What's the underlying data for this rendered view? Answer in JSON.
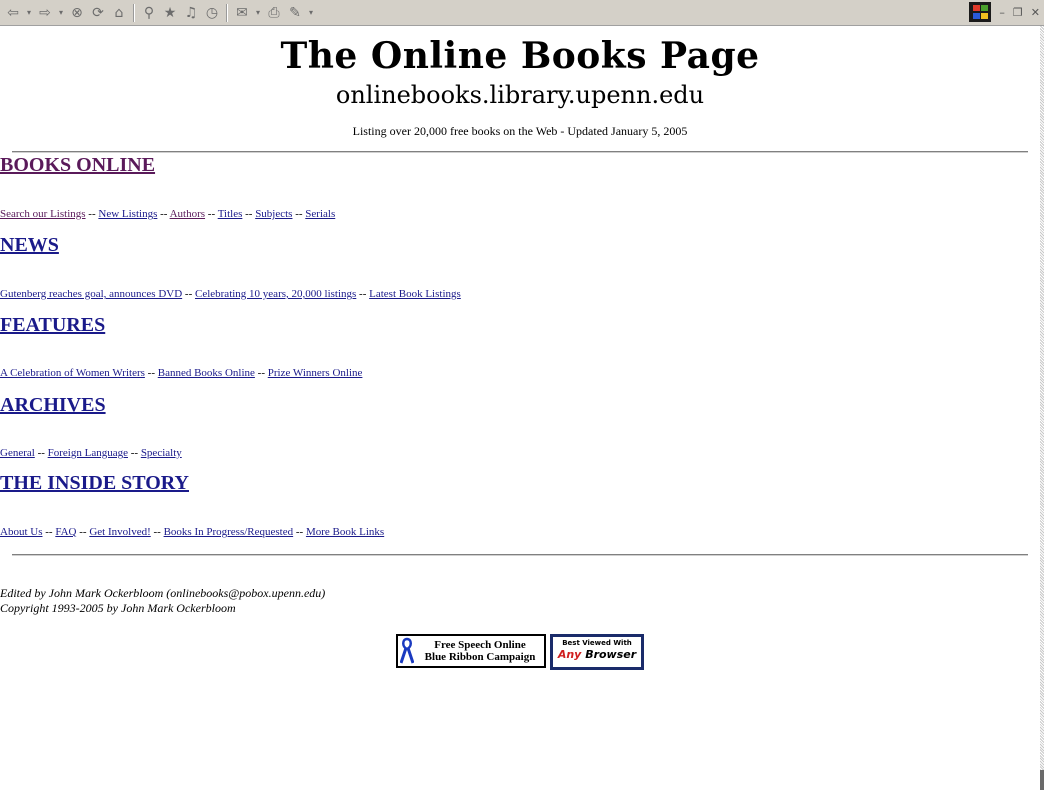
{
  "toolbar": {
    "buttons": [
      "back-icon",
      "forward-icon",
      "stop-icon",
      "refresh-icon",
      "home-icon",
      "search-icon",
      "favorites-icon",
      "media-icon",
      "history-icon",
      "mail-icon",
      "print-icon",
      "edit-icon"
    ]
  },
  "header": {
    "title": "The Online Books Page",
    "url": "onlinebooks.library.upenn.edu",
    "tagline": "Listing over 20,000 free books on the Web - Updated January 5, 2005"
  },
  "sections": {
    "books": {
      "title": "BOOKS ONLINE",
      "links": [
        "Search our Listings",
        "New Listings",
        "Authors",
        "Titles",
        "Subjects",
        "Serials"
      ]
    },
    "news": {
      "title": "NEWS",
      "links": [
        "Gutenberg reaches goal, announces DVD",
        "Celebrating 10 years, 20,000 listings",
        "Latest Book Listings"
      ]
    },
    "features": {
      "title": "FEATURES",
      "links": [
        "A Celebration of Women Writers",
        "Banned Books Online",
        "Prize Winners Online"
      ]
    },
    "archives": {
      "title": "ARCHIVES",
      "links": [
        "General",
        "Foreign Language",
        "Specialty"
      ]
    },
    "inside": {
      "title": "THE INSIDE STORY",
      "links": [
        "About Us",
        "FAQ",
        "Get Involved!",
        "Books In Progress/Requested",
        "More Book Links"
      ]
    }
  },
  "separator": "--",
  "footer": {
    "editor": "Edited by John Mark Ockerbloom (onlinebooks@pobox.upenn.edu)",
    "copyright": "Copyright 1993-2005 by John Mark Ockerbloom"
  },
  "badges": {
    "ribbon_line1": "Free Speech Online",
    "ribbon_line2": "Blue Ribbon Campaign",
    "browser_top": "Best Viewed With",
    "browser_any": "Any",
    "browser_rest": "Browser"
  },
  "colors": {
    "link": "#1a1a8a",
    "visited": "#5a1a5a"
  }
}
